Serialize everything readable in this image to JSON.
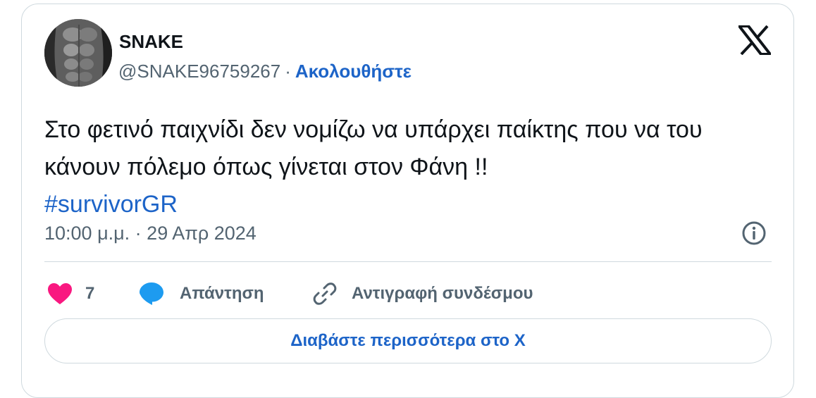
{
  "tweet": {
    "author": {
      "display_name": "SNAKE",
      "handle": "@SNAKE96759267",
      "separator": "·",
      "follow_label": "Ακολουθήστε",
      "avatar_icon": "profile-avatar-torso"
    },
    "brand_icon": "x-logo-icon",
    "text_line": "Στο φετινό παιχνίδι δεν νομίζω να υπάρχει παίκτης που να του κάνουν πόλεμο όπως γίνεται στον Φάνη !!",
    "hashtag": "#survivorGR",
    "timestamp": "10:00 μ.μ. · 29 Απρ 2024",
    "info_icon": "info-icon",
    "actions": {
      "like": {
        "icon": "heart-icon",
        "count": "7",
        "color": "#f91880"
      },
      "reply": {
        "icon": "speech-bubble-icon",
        "label": "Απάντηση",
        "color": "#1d9bf0"
      },
      "copy_link": {
        "icon": "link-icon",
        "label": "Αντιγραφή συνδέσμου"
      }
    },
    "read_more_label": "Διαβάστε περισσότερα στο X"
  },
  "colors": {
    "link_blue": "#1d64c8",
    "text_primary": "#0f1419",
    "text_secondary": "#536471",
    "border": "#cfd9de"
  }
}
